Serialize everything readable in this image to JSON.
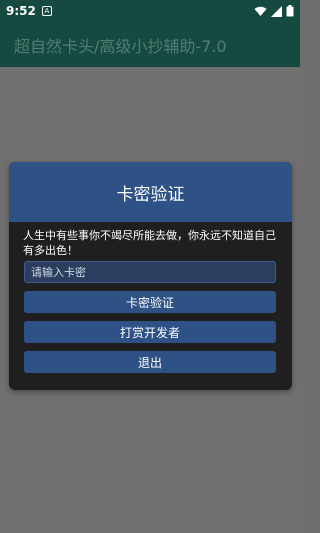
{
  "status_bar": {
    "time": "9:52",
    "app_icon": "A"
  },
  "app_bar": {
    "title": "超自然卡头/高级小抄辅助-7.0"
  },
  "dialog": {
    "title": "卡密验证",
    "message": "人生中有些事你不竭尽所能去做，你永远不知道自己有多出色！",
    "input_placeholder": "请输入卡密",
    "verify_label": "卡密验证",
    "tip_label": "打赏开发者",
    "exit_label": "退出"
  },
  "colors": {
    "app_bar": "#164a40",
    "dialog_header": "#2e5186",
    "dialog_body": "#1f1f1f",
    "overlay": "#707070"
  }
}
